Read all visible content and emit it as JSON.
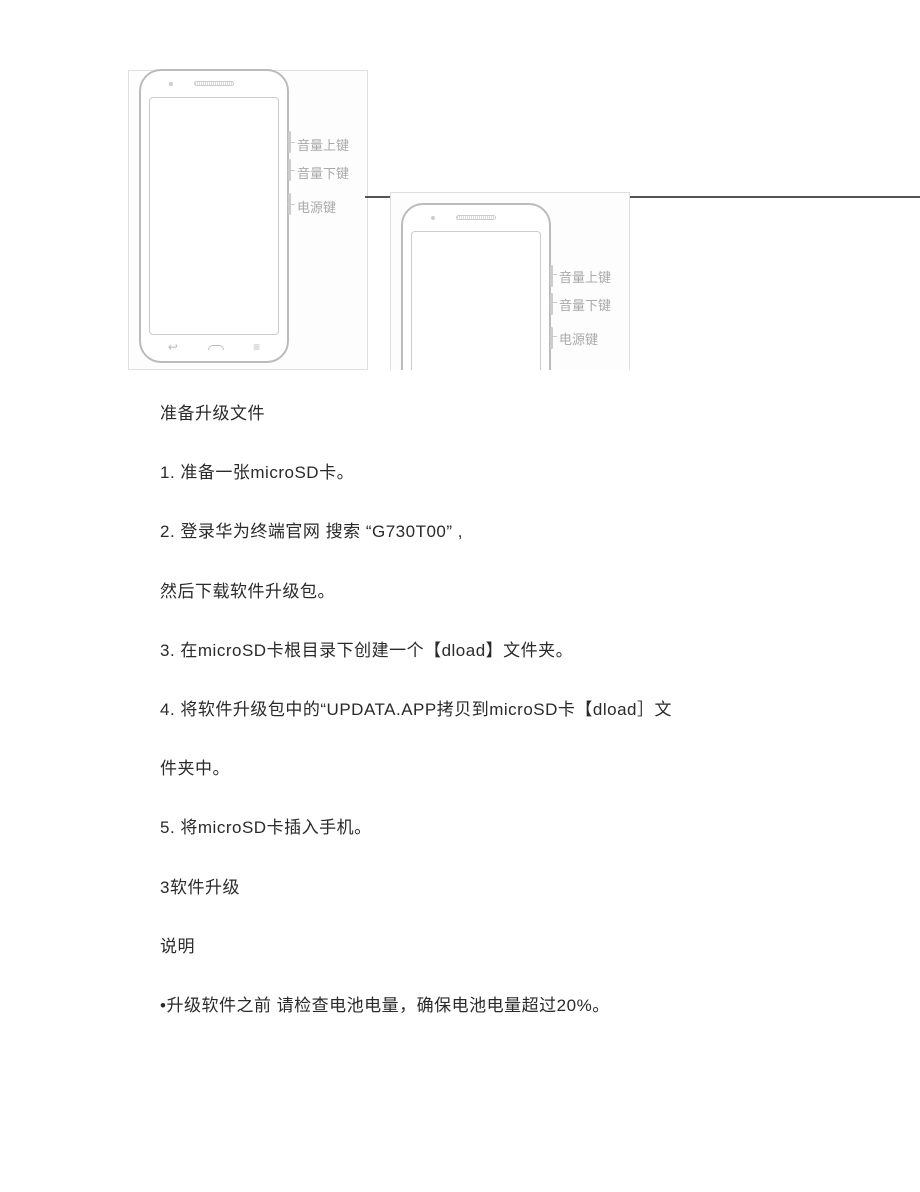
{
  "diagram": {
    "labels": {
      "vol_up": "音量上键",
      "vol_down": "音量下键",
      "power": "电源键"
    }
  },
  "text": {
    "heading_prepare": "准备升级文件",
    "step1": "1. 准备一张microSD卡。",
    "step2": "2.  登录华为终端官网  搜索   “G730T00” ,",
    "step2b": "然后下载软件升级包。",
    "step3": "3. 在microSD卡根目录下创建一个【dload】文件夹。",
    "step4": "4.     将软件升级包中的“UPDATA.APP拷贝到microSD卡【dload］文",
    "step4b": "件夹中。",
    "step5": "5. 将microSD卡插入手机。",
    "heading_upgrade": "3软件升级",
    "note_heading": "说明",
    "note1": "•升级软件之前  请检查电池电量，确保电池电量超过20%。"
  }
}
